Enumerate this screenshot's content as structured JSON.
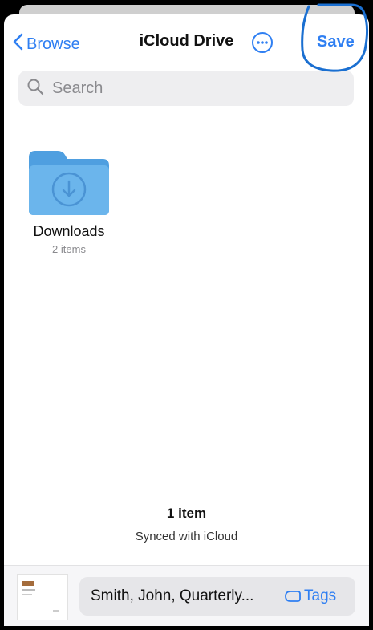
{
  "nav": {
    "back_label": "Browse",
    "title": "iCloud Drive",
    "save_label": "Save"
  },
  "search": {
    "placeholder": "Search"
  },
  "folders": [
    {
      "name": "Downloads",
      "subtitle": "2 items",
      "icon": "folder-download-icon"
    }
  ],
  "status": {
    "count": "1 item",
    "sync": "Synced with iCloud"
  },
  "bottom_bar": {
    "file_name": "Smith, John, Quarterly...",
    "tags_label": "Tags"
  },
  "colors": {
    "accent": "#2f7ff2",
    "folder": "#5aa9e6",
    "annotation": "#1a6fd1"
  }
}
